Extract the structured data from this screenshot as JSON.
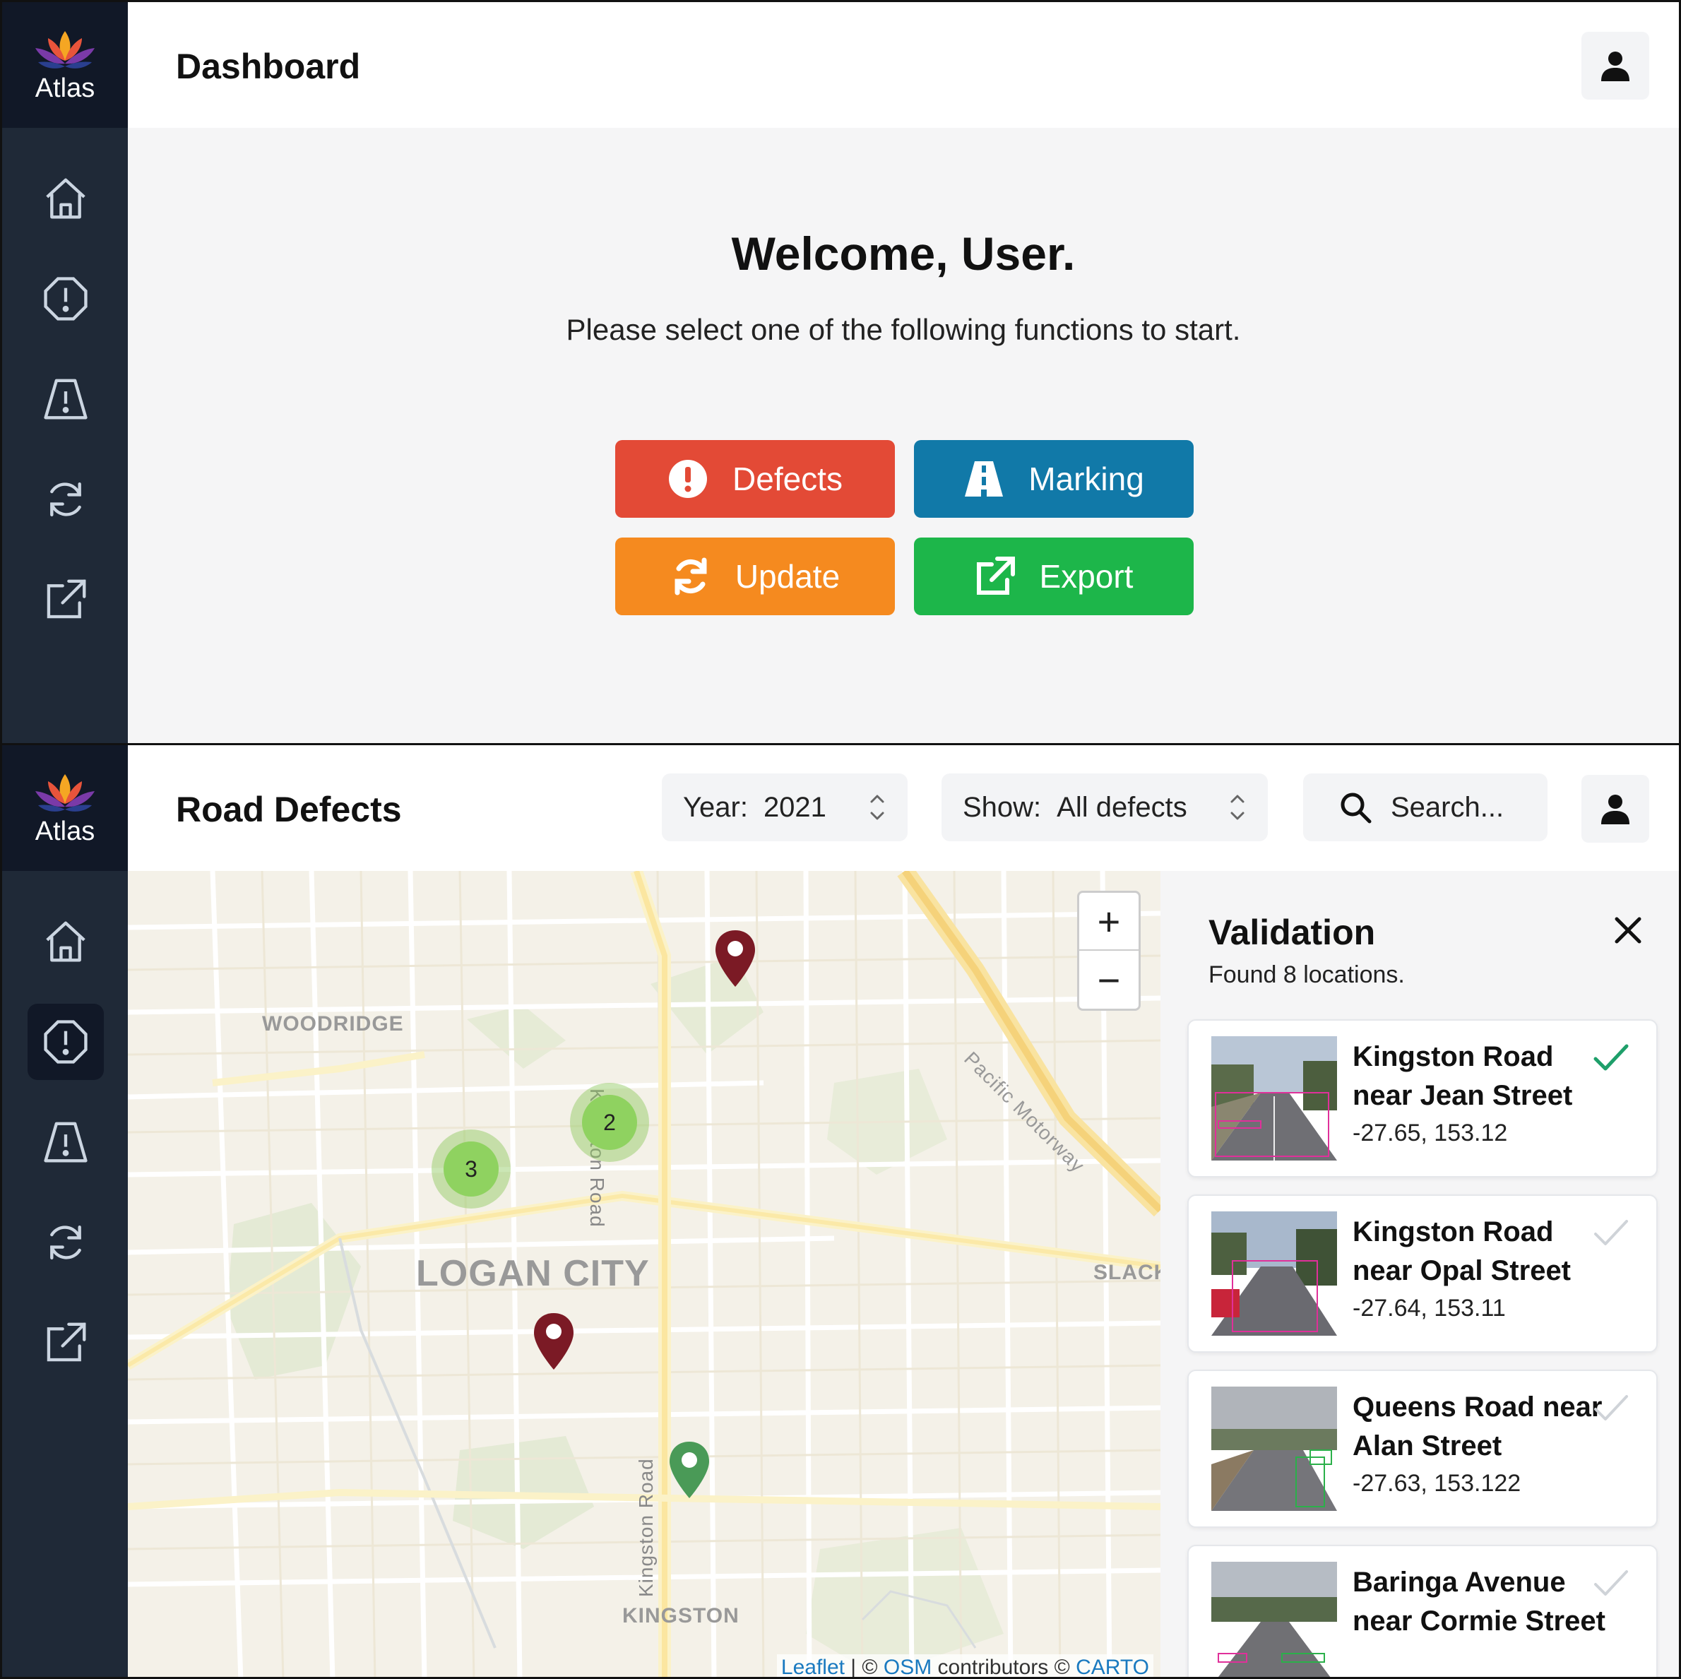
{
  "brand": {
    "name": "Atlas"
  },
  "nav_icons": [
    "home-icon",
    "alert-circle-icon",
    "road-warning-icon",
    "sync-icon",
    "external-link-icon"
  ],
  "dashboard": {
    "title": "Dashboard",
    "welcome": "Welcome, User.",
    "subtitle": "Please select one of the following functions to start.",
    "buttons": {
      "defects": {
        "label": "Defects",
        "color": "#e34a36",
        "icon": "alert-circle-icon"
      },
      "marking": {
        "label": "Marking",
        "color": "#1179a8",
        "icon": "road-warning-icon"
      },
      "update": {
        "label": "Update",
        "color": "#f58a1f",
        "icon": "sync-icon"
      },
      "export": {
        "label": "Export",
        "color": "#1db64a",
        "icon": "external-link-icon"
      }
    }
  },
  "road_defects": {
    "title": "Road Defects",
    "year": {
      "label": "Year:",
      "value": "2021"
    },
    "show": {
      "label": "Show:",
      "value": "All defects"
    },
    "search": {
      "placeholder": "Search..."
    },
    "map": {
      "zoom_in": "+",
      "zoom_out": "−",
      "labels": {
        "woodridge": "WOODRIDGE",
        "logan_city": "LOGAN CITY",
        "slacks": "SLACK",
        "kingston": "KINGSTON",
        "kingston_road_1": "Kingston Road",
        "kingston_road_2": "Kingston Road",
        "pacific_motorway": "Pacific Motorway"
      },
      "clusters": {
        "a": "2",
        "b": "3"
      },
      "attribution": {
        "leaflet": "Leaflet",
        "sep": " | © ",
        "osm": "OSM",
        "contrib": " contributors © ",
        "carto": "CARTO"
      }
    },
    "validation": {
      "title": "Validation",
      "count": "Found 8 locations.",
      "items": [
        {
          "title": "Kingston Road near Jean Street",
          "coords": "-27.65, 153.12",
          "validated": true
        },
        {
          "title": "Kingston Road near Opal Street",
          "coords": "-27.64, 153.11",
          "validated": false
        },
        {
          "title": "Queens Road near Alan Street",
          "coords": "-27.63, 153.122",
          "validated": false
        },
        {
          "title": "Baringa Avenue near Cormie Street",
          "coords": "",
          "validated": false
        }
      ]
    }
  },
  "colors": {
    "sidebar": "#1f2937",
    "brand_bg": "#111827",
    "defect_pin": "#7b1a25",
    "ok_pin": "#4a9a57",
    "check_active": "#1e9f6a",
    "check_inactive": "#cfd3d8"
  }
}
